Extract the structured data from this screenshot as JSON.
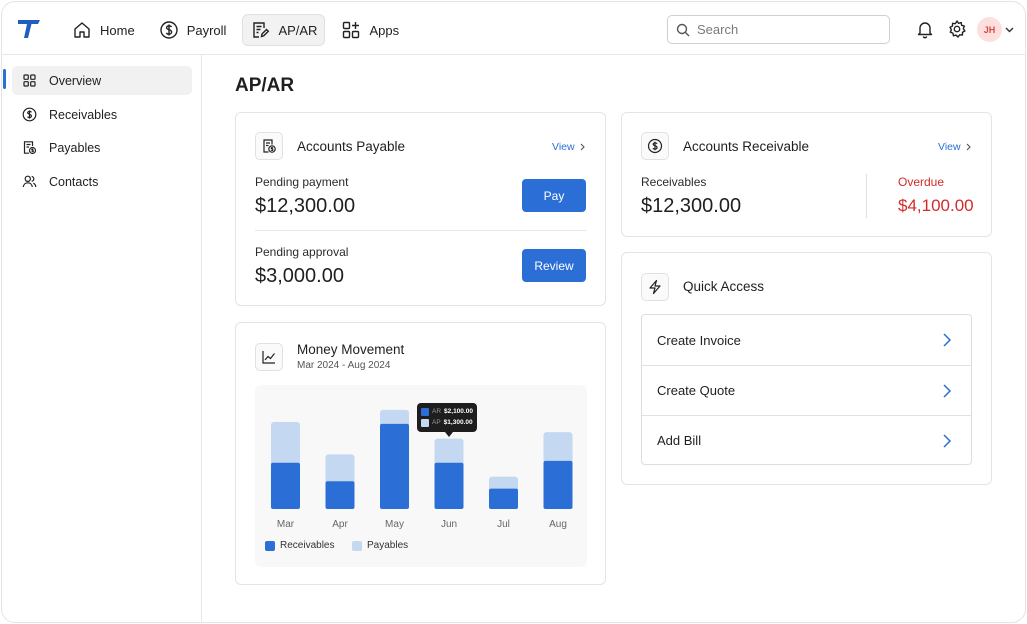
{
  "nav": {
    "items": [
      {
        "label": "Home",
        "icon": "home-icon"
      },
      {
        "label": "Payroll",
        "icon": "dollar-circle-icon"
      },
      {
        "label": "AP/AR",
        "icon": "document-pen-icon"
      },
      {
        "label": "Apps",
        "icon": "apps-grid-icon"
      }
    ],
    "active": "AP/AR"
  },
  "search": {
    "placeholder": "Search"
  },
  "user": {
    "initials": "JH"
  },
  "sidebar": {
    "items": [
      {
        "label": "Overview",
        "icon": "grid-icon"
      },
      {
        "label": "Receivables",
        "icon": "dollar-circle-icon"
      },
      {
        "label": "Payables",
        "icon": "invoice-icon"
      },
      {
        "label": "Contacts",
        "icon": "people-icon"
      }
    ],
    "active": "Overview"
  },
  "page": {
    "title": "AP/AR"
  },
  "payable": {
    "title": "Accounts Payable",
    "view_label": "View",
    "pending_payment_label": "Pending payment",
    "pending_payment_amount": "$12,300.00",
    "pay_label": "Pay",
    "pending_approval_label": "Pending approval",
    "pending_approval_amount": "$3,000.00",
    "review_label": "Review"
  },
  "receivable": {
    "title": "Accounts Receivable",
    "view_label": "View",
    "receivables_label": "Receivables",
    "receivables_amount": "$12,300.00",
    "overdue_label": "Overdue",
    "overdue_amount": "$4,100.00",
    "overdue_color": "#d12b2b"
  },
  "money_movement": {
    "title": "Money Movement",
    "subtitle": "Mar 2024 - Aug 2024"
  },
  "quick_access": {
    "title": "Quick Access",
    "items": [
      "Create Invoice",
      "Create Quote",
      "Add Bill"
    ]
  },
  "colors": {
    "accent": "#2b6fd6",
    "receivables": "#2b6fd6",
    "payables": "#c5d8f2"
  },
  "chart_data": {
    "type": "bar",
    "stacked": true,
    "categories": [
      "Mar",
      "Apr",
      "May",
      "Jun",
      "Jul",
      "Aug"
    ],
    "series": [
      {
        "name": "Receivables",
        "values": [
          2500,
          1500,
          4600,
          2500,
          1100,
          2600
        ]
      },
      {
        "name": "Payables",
        "values": [
          2200,
          1450,
          750,
          1300,
          650,
          1550
        ]
      }
    ],
    "tooltip": {
      "category": "Jun",
      "ar_key": "AR",
      "ar_value": "$2,100.00",
      "ap_key": "AP",
      "ap_value": "$1,300.00"
    },
    "legend_position": "bottom-left",
    "grid": false
  }
}
